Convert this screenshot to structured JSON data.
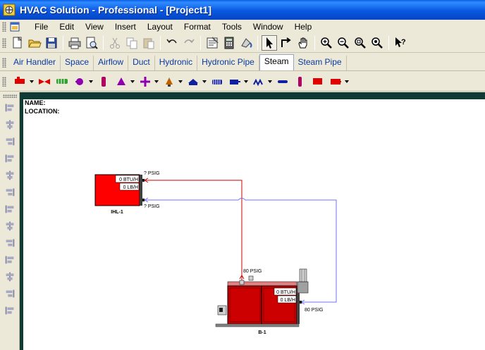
{
  "window": {
    "title": "HVAC Solution - Professional - [Project1]"
  },
  "menu": {
    "items": [
      {
        "label": "File",
        "name": "menu-file"
      },
      {
        "label": "Edit",
        "name": "menu-edit"
      },
      {
        "label": "View",
        "name": "menu-view"
      },
      {
        "label": "Insert",
        "name": "menu-insert"
      },
      {
        "label": "Layout",
        "name": "menu-layout"
      },
      {
        "label": "Format",
        "name": "menu-format"
      },
      {
        "label": "Tools",
        "name": "menu-tools"
      },
      {
        "label": "Window",
        "name": "menu-window"
      },
      {
        "label": "Help",
        "name": "menu-help"
      }
    ]
  },
  "toolbar": {
    "buttons": [
      "new-document-icon",
      "open-folder-icon",
      "save-icon",
      "|",
      "print-icon",
      "print-preview-icon",
      "|",
      "cut-icon",
      "copy-icon",
      "paste-icon",
      "|",
      "undo-icon",
      "redo-icon",
      "|",
      "properties-icon",
      "calculator-icon",
      "paint-icon",
      "|",
      "pointer-icon",
      "connector-icon",
      "pan-hand-icon",
      "|",
      "zoom-in-icon",
      "zoom-out-icon",
      "zoom-fit-icon",
      "zoom-window-icon",
      "|",
      "context-help-icon"
    ],
    "active": "pointer-icon"
  },
  "tabs": [
    {
      "label": "Air Handler"
    },
    {
      "label": "Space"
    },
    {
      "label": "Airflow"
    },
    {
      "label": "Duct"
    },
    {
      "label": "Hydronic"
    },
    {
      "label": "Hydronic Pipe"
    },
    {
      "label": "Steam",
      "active": true
    },
    {
      "label": "Steam Pipe"
    }
  ],
  "palette": [
    {
      "name": "boiler-component-icon",
      "color": "#e00000",
      "dropdown": true
    },
    {
      "name": "steam-valve-component-icon",
      "color": "#e00000",
      "dropdown": false
    },
    {
      "name": "heat-exchanger-component-icon",
      "color": "#30a030",
      "dropdown": false
    },
    {
      "name": "pump-component-icon",
      "color": "#9000b0",
      "dropdown": true
    },
    {
      "name": "tank-component-icon",
      "color": "#b00060",
      "dropdown": false
    },
    {
      "name": "separator-component-icon",
      "color": "#9000b0",
      "dropdown": true
    },
    {
      "name": "trap-component-icon",
      "color": "#9000b0",
      "dropdown": true
    },
    {
      "name": "pressure-reducer-component-icon",
      "color": "#c06000",
      "dropdown": true
    },
    {
      "name": "unit-heater-component-icon",
      "color": "#1020a0",
      "dropdown": true
    },
    {
      "name": "radiator-component-icon",
      "color": "#1020a0",
      "dropdown": false
    },
    {
      "name": "coil-component-icon",
      "color": "#1020a0",
      "dropdown": true
    },
    {
      "name": "convector-component-icon",
      "color": "#1020a0",
      "dropdown": true
    },
    {
      "name": "fitting-component-icon",
      "color": "#1020a0",
      "dropdown": false
    },
    {
      "name": "pipe-component-icon",
      "color": "#b00060",
      "dropdown": false
    },
    {
      "name": "gauge-component-icon",
      "color": "#e00000",
      "dropdown": false
    },
    {
      "name": "steam-load-component-icon",
      "color": "#e00000",
      "dropdown": true
    }
  ],
  "sidebar_tools": [
    "align-left-icon",
    "align-center-icon",
    "align-right-icon",
    "align-top-icon",
    "align-middle-icon",
    "align-bottom-icon",
    "space-horizontal-icon",
    "space-vertical-icon",
    "same-width-icon",
    "same-height-icon",
    "same-size-icon",
    "group-icon",
    "ungroup-icon"
  ],
  "drawing": {
    "name_label": "NAME:",
    "location_label": "LOCATION:",
    "load": {
      "id": "IHL-1",
      "btuh": "0 BTU/H",
      "lbh": "0 LB/H",
      "supply_pressure": "? PSIG",
      "return_pressure": "? PSIG",
      "fill": "#ff0000"
    },
    "boiler": {
      "id": "B-1",
      "btuh": "0 BTU/H",
      "lbh": "0 LB/H",
      "supply_pressure": "80 PSIG",
      "return_pressure": "80 PSIG",
      "fill": "#cc0000"
    },
    "colors": {
      "steam_line": "#cc0000",
      "condensate_line": "#7070ff"
    }
  }
}
